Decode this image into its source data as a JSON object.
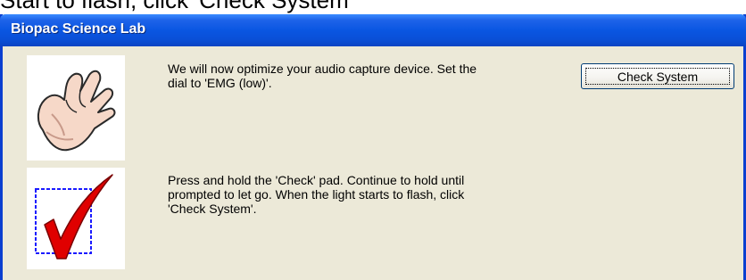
{
  "background_text": "Start to flash, click 'Check System'",
  "window": {
    "title": "Biopac Science Lab"
  },
  "steps": [
    {
      "icon": "hand-icon",
      "message_lines": [
        "We will now optimize your audio capture device. Set the",
        "dial to 'EMG (low)'."
      ]
    },
    {
      "icon": "checkmark-icon",
      "message_lines": [
        "Press and hold the 'Check' pad.  Continue to hold until",
        "prompted to let go. When the light starts to flash, click",
        "'Check System'."
      ]
    }
  ],
  "check_button": {
    "label": "Check System"
  },
  "colors": {
    "titlebar": "#0a56e2",
    "dialog_bg": "#ece9d8",
    "check_red": "#e00000",
    "box_blue": "#1a1aff"
  }
}
